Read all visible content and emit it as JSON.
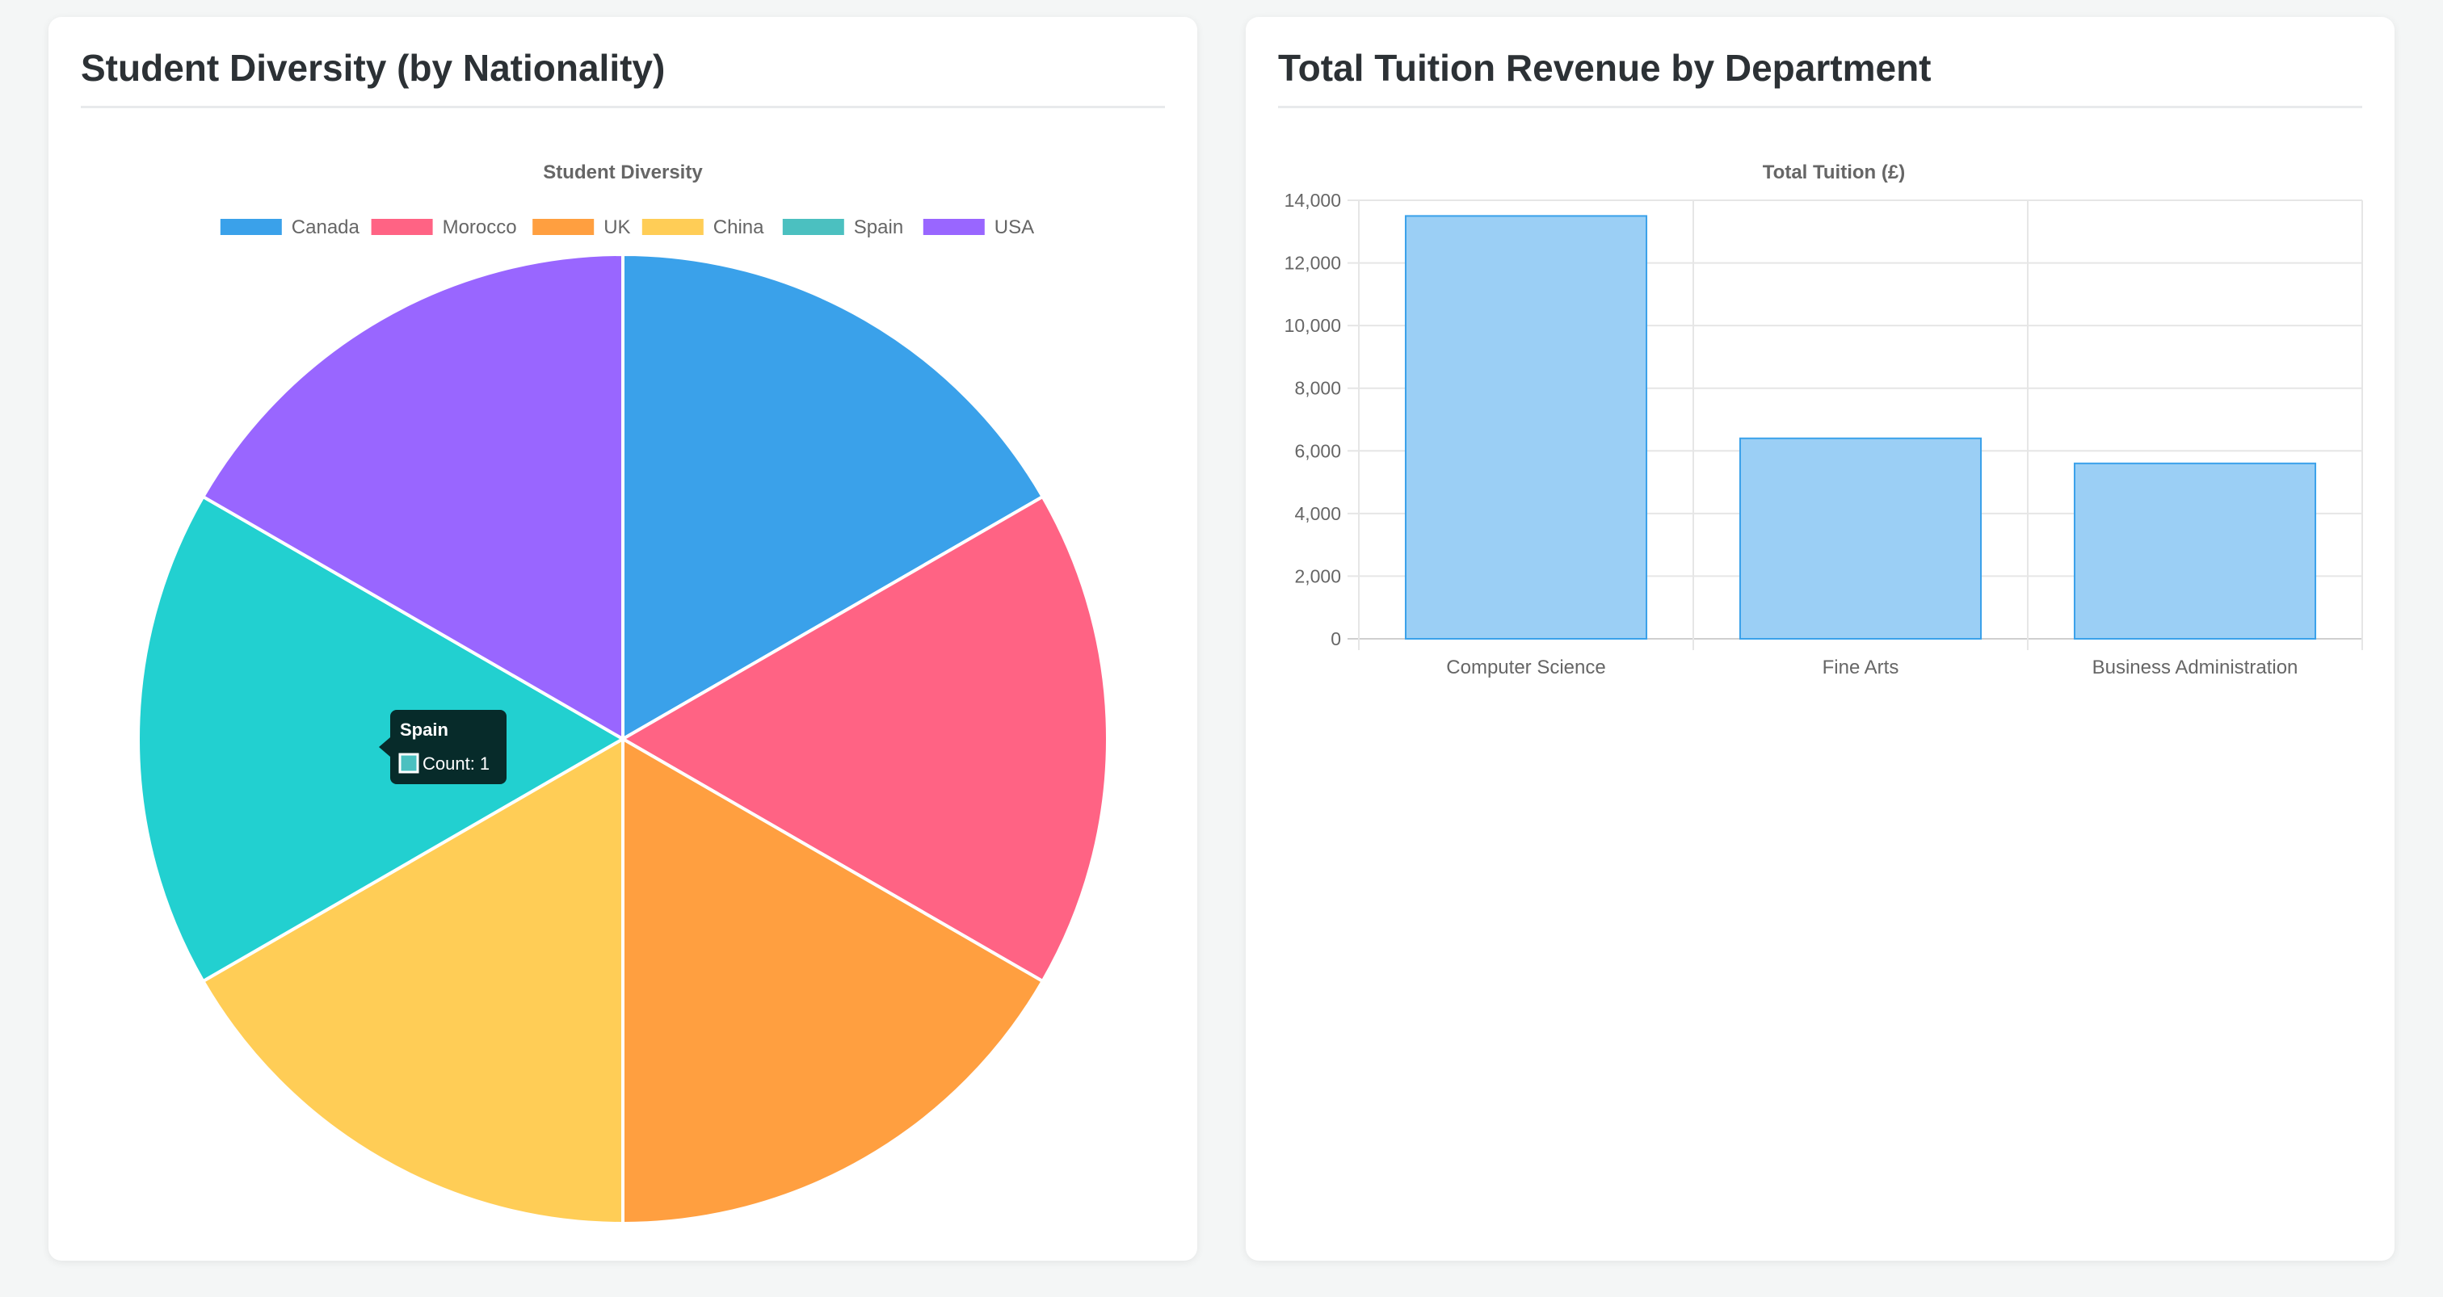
{
  "cards": {
    "diversity": {
      "heading": "Student Diversity (by Nationality)"
    },
    "tuition": {
      "heading": "Total Tuition Revenue by Department"
    }
  },
  "chart_data": [
    {
      "type": "pie",
      "title": "Student Diversity",
      "legend_position": "top",
      "categories": [
        "Canada",
        "Morocco",
        "UK",
        "China",
        "Spain",
        "USA"
      ],
      "values": [
        1,
        1,
        1,
        1,
        1,
        1
      ],
      "colors": [
        "#3aa1ea",
        "#ff6384",
        "#ff9f40",
        "#ffcd56",
        "#22d0d0",
        "#9966ff"
      ],
      "legend_colors": [
        "#3aa1ea",
        "#ff6384",
        "#ff9f40",
        "#ffcd56",
        "#4bc0c0",
        "#9966ff"
      ],
      "tooltip": {
        "title": "Spain",
        "label": "Count: 1",
        "swatch_color": "#4bc0c0"
      }
    },
    {
      "type": "bar",
      "title": "Total Tuition (£)",
      "categories": [
        "Computer Science",
        "Fine Arts",
        "Business Administration"
      ],
      "values": [
        13500,
        6400,
        5600
      ],
      "ylim": [
        0,
        14000
      ],
      "yticks": [
        0,
        2000,
        4000,
        6000,
        8000,
        10000,
        12000,
        14000
      ],
      "ytick_labels": [
        "0",
        "2,000",
        "4,000",
        "6,000",
        "8,000",
        "10,000",
        "12,000",
        "14,000"
      ],
      "grid": true,
      "bar_color": "#9bcff5",
      "bar_border": "#3aa1ea"
    }
  ]
}
